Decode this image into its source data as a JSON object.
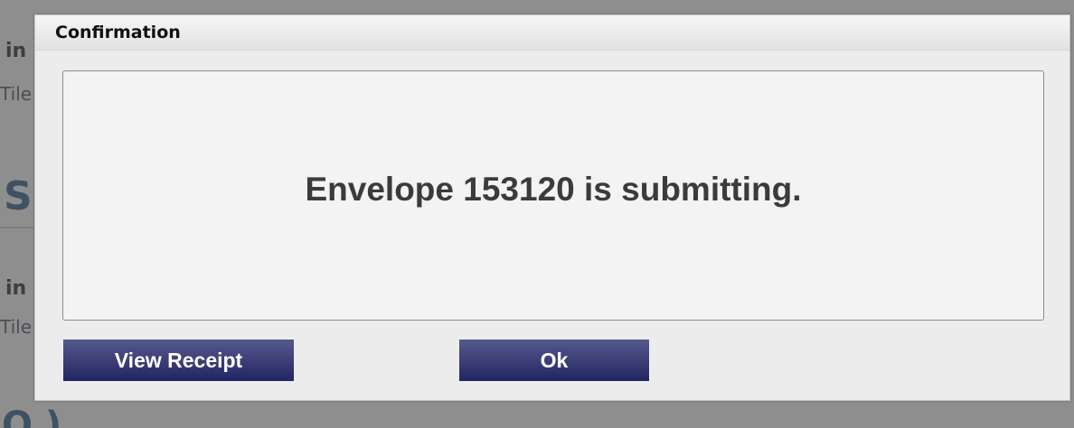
{
  "background": {
    "fragments": [
      "in",
      "Tile",
      "S",
      "in",
      "Tile",
      "O )"
    ]
  },
  "dialog": {
    "title": "Confirmation",
    "message": "Envelope 153120 is submitting.",
    "buttons": {
      "view_receipt": "View Receipt",
      "ok": "Ok"
    }
  },
  "colors": {
    "overlay": "#8e8e8e",
    "dialog_bg": "#ececec",
    "button_bg": "#2f3270",
    "button_text": "#ffffff",
    "message_text": "#3b3b3b"
  }
}
